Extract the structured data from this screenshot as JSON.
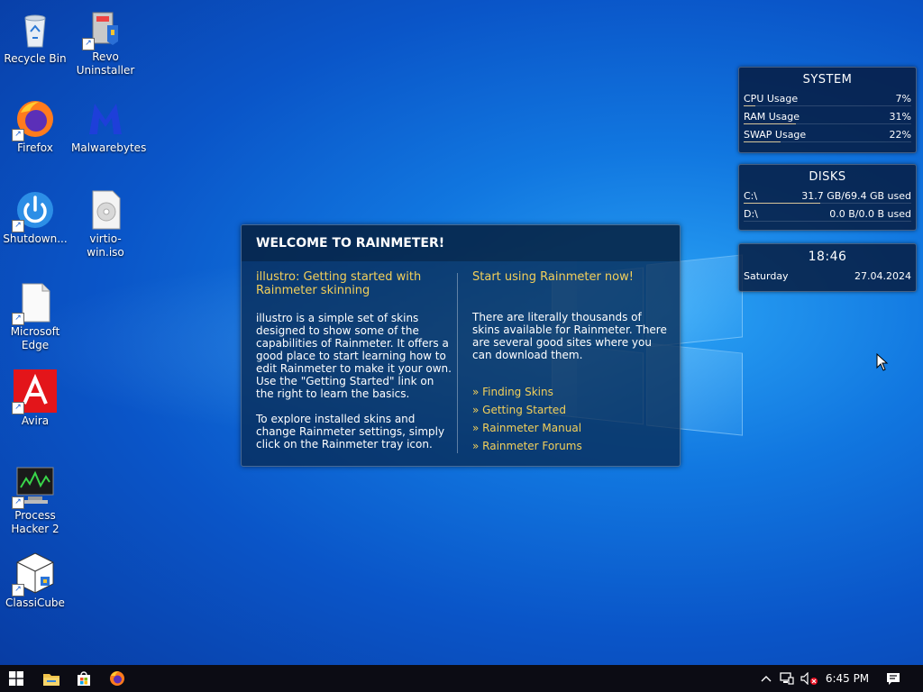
{
  "desktop": {
    "icons": [
      {
        "label": "Recycle Bin"
      },
      {
        "label": "Revo Uninstaller"
      },
      {
        "label": "Firefox"
      },
      {
        "label": "Malwarebytes"
      },
      {
        "label": "Shutdown..."
      },
      {
        "label": "virtio-win.iso"
      },
      {
        "label": "Microsoft Edge"
      },
      {
        "label": "Avira"
      },
      {
        "label": "Process Hacker 2"
      },
      {
        "label": "ClassiCube"
      }
    ]
  },
  "system_skin": {
    "title": "SYSTEM",
    "rows": [
      {
        "label": "CPU Usage",
        "value": "7%",
        "fraction": 0.07
      },
      {
        "label": "RAM Usage",
        "value": "31%",
        "fraction": 0.31
      },
      {
        "label": "SWAP Usage",
        "value": "22%",
        "fraction": 0.22
      }
    ]
  },
  "disks_skin": {
    "title": "DISKS",
    "rows": [
      {
        "label": "C:\\",
        "value": "31.7 GB/69.4 GB used",
        "fraction": 0.457
      },
      {
        "label": "D:\\",
        "value": "0.0 B/0.0 B used",
        "fraction": 0.0
      }
    ]
  },
  "clock_skin": {
    "time": "18:46",
    "day": "Saturday",
    "date": "27.04.2024"
  },
  "welcome": {
    "title": "WELCOME TO RAINMETER!",
    "left": {
      "heading": "illustro: Getting started with Rainmeter skinning",
      "para1": "illustro is a simple set of skins designed to show some of the capabilities of Rainmeter. It offers a good place to start learning how to edit Rainmeter to make it your own. Use the \"Getting Started\" link on the right to learn the basics.",
      "para2": "To explore installed skins and change Rainmeter settings, simply click on the Rainmeter tray icon."
    },
    "right": {
      "heading": "Start using Rainmeter now!",
      "para": "There are literally thousands of skins available for Rainmeter. There are several good sites where you can download them.",
      "links": [
        "» Finding Skins",
        "» Getting Started",
        "» Rainmeter Manual",
        "» Rainmeter Forums"
      ]
    }
  },
  "taskbar": {
    "clock": "6:45 PM",
    "icons": [
      "windows-start-icon",
      "file-explorer-icon",
      "microsoft-store-icon",
      "firefox-icon"
    ],
    "tray_icons": [
      "chevron-up-icon",
      "network-icon",
      "volume-muted-icon",
      "notification-icon"
    ]
  },
  "colors": {
    "accent_gold": "#f2cf5a",
    "skin_bg": "#06183a",
    "taskbar_bg": "#0c0c14"
  }
}
